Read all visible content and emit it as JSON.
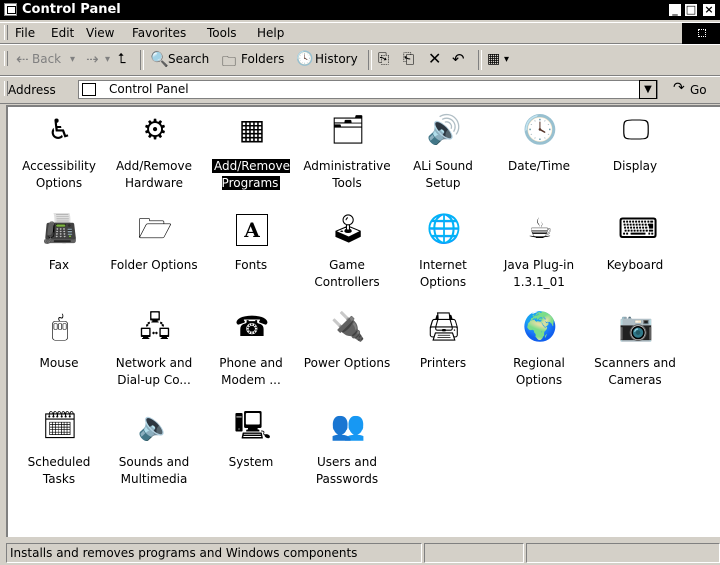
{
  "window": {
    "title": "Control Panel",
    "controls": {
      "minimize": "_",
      "maximize": "□",
      "close": "×"
    }
  },
  "menu": [
    "File",
    "Edit",
    "View",
    "Favorites",
    "Tools",
    "Help"
  ],
  "toolbar": {
    "back": "Back",
    "search": "Search",
    "folders": "Folders",
    "history": "History"
  },
  "address": {
    "label": "Address",
    "value": "Control Panel",
    "go": "Go"
  },
  "items": [
    {
      "label": "Accessibility Options",
      "icon": "accessibility-icon",
      "selected": false
    },
    {
      "label": "Add/Remove Hardware",
      "icon": "add-hardware-icon",
      "selected": false
    },
    {
      "label": "Add/Remove Programs",
      "icon": "add-programs-icon",
      "selected": true
    },
    {
      "label": "Administrative Tools",
      "icon": "admin-tools-icon",
      "selected": false
    },
    {
      "label": "ALi Sound Setup",
      "icon": "sound-setup-icon",
      "selected": false
    },
    {
      "label": "Date/Time",
      "icon": "date-time-icon",
      "selected": false
    },
    {
      "label": "Display",
      "icon": "display-icon",
      "selected": false
    },
    {
      "label": "Fax",
      "icon": "fax-icon",
      "selected": false
    },
    {
      "label": "Folder Options",
      "icon": "folder-options-icon",
      "selected": false
    },
    {
      "label": "Fonts",
      "icon": "fonts-icon",
      "selected": false
    },
    {
      "label": "Game Controllers",
      "icon": "joystick-icon",
      "selected": false
    },
    {
      "label": "Internet Options",
      "icon": "internet-options-icon",
      "selected": false
    },
    {
      "label": "Java Plug-in 1.3.1_01",
      "icon": "java-icon",
      "selected": false
    },
    {
      "label": "Keyboard",
      "icon": "keyboard-icon",
      "selected": false
    },
    {
      "label": "Mouse",
      "icon": "mouse-icon",
      "selected": false
    },
    {
      "label": "Network and Dial-up Co...",
      "icon": "network-icon",
      "selected": false
    },
    {
      "label": "Phone and Modem ...",
      "icon": "phone-icon",
      "selected": false
    },
    {
      "label": "Power Options",
      "icon": "power-icon",
      "selected": false
    },
    {
      "label": "Printers",
      "icon": "printers-icon",
      "selected": false
    },
    {
      "label": "Regional Options",
      "icon": "globe-icon",
      "selected": false
    },
    {
      "label": "Scanners and Cameras",
      "icon": "scanner-icon",
      "selected": false
    },
    {
      "label": "Scheduled Tasks",
      "icon": "scheduled-tasks-icon",
      "selected": false
    },
    {
      "label": "Sounds and Multimedia",
      "icon": "speaker-icon",
      "selected": false
    },
    {
      "label": "System",
      "icon": "computer-icon",
      "selected": false
    },
    {
      "label": "Users and Passwords",
      "icon": "users-icon",
      "selected": false
    }
  ],
  "status": {
    "text": "Installs and removes programs and Windows components"
  }
}
